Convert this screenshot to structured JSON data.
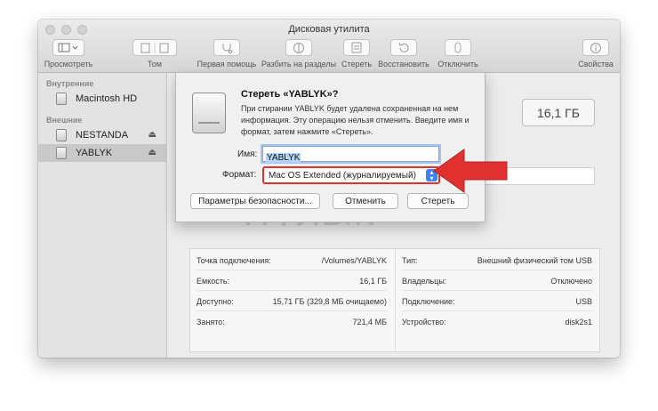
{
  "window": {
    "title": "Дисковая утилита"
  },
  "toolbar": {
    "view_label": "Просмотреть",
    "volume_label": "Том",
    "first_aid_label": "Первая помощь",
    "partition_label": "Разбить на разделы",
    "erase_label": "Стереть",
    "restore_label": "Восстановить",
    "unmount_label": "Отключить",
    "info_label": "Свойства"
  },
  "sidebar": {
    "internal_header": "Внутренние",
    "external_header": "Внешние",
    "items": [
      {
        "label": "Macintosh HD"
      },
      {
        "label": "NESTANDA"
      },
      {
        "label": "YABLYK"
      }
    ]
  },
  "main": {
    "capacity": "16,1 ГБ",
    "info_left": [
      {
        "key": "Точка подключения:",
        "value": "/Volumes/YABLYK"
      },
      {
        "key": "Емкость:",
        "value": "16,1 ГБ"
      },
      {
        "key": "Доступно:",
        "value": "15,71 ГБ (329,8 МБ очищаемо)"
      },
      {
        "key": "Занято:",
        "value": "721,4 МБ"
      }
    ],
    "info_right": [
      {
        "key": "Тип:",
        "value": "Внешний физический том USB"
      },
      {
        "key": "Владельцы:",
        "value": "Отключено"
      },
      {
        "key": "Подключение:",
        "value": "USB"
      },
      {
        "key": "Устройство:",
        "value": "disk2s1"
      }
    ]
  },
  "dialog": {
    "title": "Стереть «YABLYK»?",
    "message": "При стирании YABLYK будет удалена сохраненная на нем информация. Эту операцию нельзя отменить. Введите имя и формат, затем нажмите «Стереть».",
    "name_label": "Имя:",
    "name_value": "YABLYK",
    "format_label": "Формат:",
    "format_value": "Mac OS Extended (журналируемый)",
    "security_button": "Параметры безопасности...",
    "cancel_button": "Отменить",
    "erase_button": "Стереть"
  },
  "watermark": "ЯФЛЫК",
  "colors": {
    "highlight_red": "#e03030",
    "accent_blue": "#3b82f6"
  }
}
